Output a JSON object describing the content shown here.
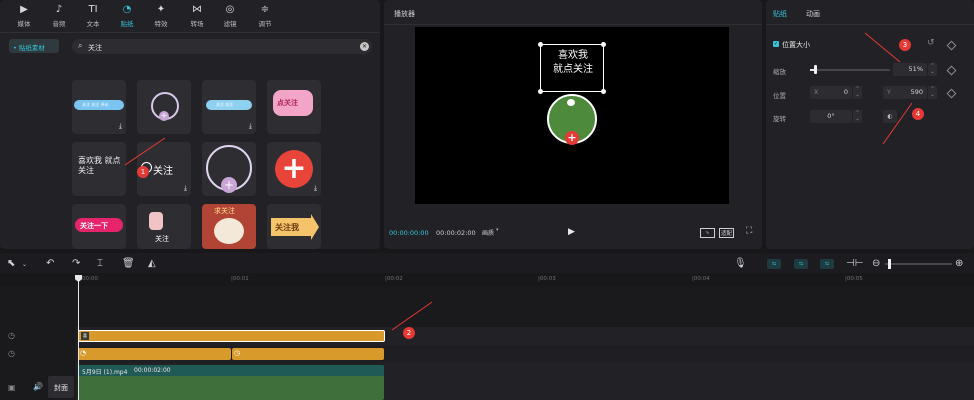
{
  "toolbar": {
    "tabs": [
      {
        "label": "媒体",
        "icon": "media-icon"
      },
      {
        "label": "音频",
        "icon": "audio-icon"
      },
      {
        "label": "文本",
        "icon": "text-icon"
      },
      {
        "label": "贴纸",
        "icon": "sticker-icon",
        "active": true
      },
      {
        "label": "特效",
        "icon": "effects-icon"
      },
      {
        "label": "转场",
        "icon": "transition-icon"
      },
      {
        "label": "滤镜",
        "icon": "filter-icon"
      },
      {
        "label": "调节",
        "icon": "adjust-icon"
      }
    ],
    "icon_glyphs": [
      "▶",
      "♪",
      "TI",
      "◔",
      "✦",
      "⋈",
      "◎",
      "≑"
    ]
  },
  "sticker_library": {
    "category": "• 贴纸素材",
    "search_value": "关注",
    "tiles": [
      {
        "caption": "关注 关注 评论"
      },
      {
        "caption": ""
      },
      {
        "caption": "关注 关注"
      },
      {
        "caption": "点关注"
      },
      {
        "caption": "喜欢我 就点关注"
      },
      {
        "caption": "关注"
      },
      {
        "caption": ""
      },
      {
        "caption": ""
      },
      {
        "caption": "关注一下"
      },
      {
        "caption": "关注"
      },
      {
        "caption": "求关注"
      },
      {
        "caption": "关注我"
      }
    ]
  },
  "player": {
    "title": "播放器",
    "sticker_text": "喜欢我\n就点关注",
    "current_time": "00:00:00:00",
    "total_time": "00:00:02:00",
    "view_mode": "画质",
    "ratio": "适配"
  },
  "properties": {
    "tab_sticker": "贴纸",
    "tab_animation": "动画",
    "section_title": "位置大小",
    "scale_label": "缩放",
    "scale_value": "51%",
    "position_label": "位置",
    "x_label": "X",
    "x_value": "0",
    "y_label": "Y",
    "y_value": "590",
    "rotate_label": "旋转",
    "rotate_value": "0°"
  },
  "timeline": {
    "ticks": [
      "00:00",
      "|00:01",
      "|00:02",
      "|00:03",
      "|00:04",
      "|00:05"
    ],
    "clip_label": "5月9日 (1).mp4",
    "clip_duration": "00:00:02:00",
    "cover_label": "封面"
  },
  "annotations": [
    "1",
    "2",
    "3",
    "4"
  ],
  "colors": {
    "accent": "#36c4d8",
    "sticker_track": "#d89a2b",
    "video_track": "#3f6f3a",
    "video_header": "#1f5a56",
    "annotation": "#e53935"
  }
}
